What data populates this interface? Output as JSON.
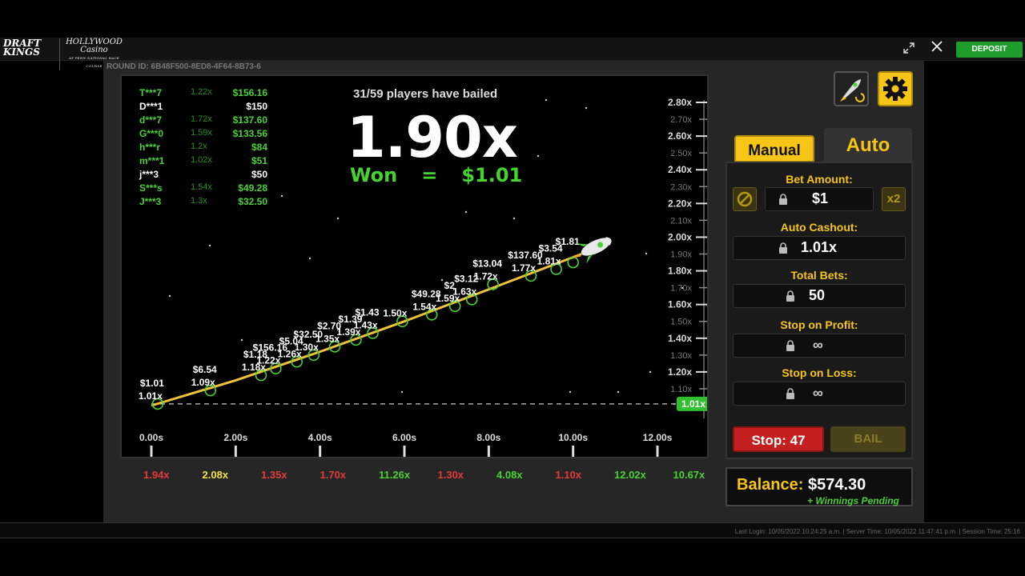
{
  "topbar": {
    "brand_line1": "DRAFT",
    "brand_line2": "KINGS",
    "casino_name": "HOLLYWOOD",
    "casino_name2": "Casino",
    "casino_sub": "AT PENN NATIONAL RACE COURSE",
    "deposit_label": "DEPOSIT"
  },
  "round_id": "ROUND ID: 6B48F500-8ED8-4F64-8B73-6",
  "status": {
    "bail_count": "31/59 players have bailed",
    "multiplier": "1.90x",
    "won_label": "Won",
    "won_eq": "=",
    "won_amount": "$1.01"
  },
  "players": [
    {
      "name": "T***7",
      "mult": "1.22x",
      "amount": "$156.16",
      "color": "green"
    },
    {
      "name": "D***1",
      "mult": "",
      "amount": "$150",
      "color": "white"
    },
    {
      "name": "d***7",
      "mult": "1.72x",
      "amount": "$137.60",
      "color": "green"
    },
    {
      "name": "G***0",
      "mult": "1.59x",
      "amount": "$133.56",
      "color": "green"
    },
    {
      "name": "h***r",
      "mult": "1.2x",
      "amount": "$84",
      "color": "green"
    },
    {
      "name": "m***1",
      "mult": "1.02x",
      "amount": "$51",
      "color": "green"
    },
    {
      "name": "j***3",
      "mult": "",
      "amount": "$50",
      "color": "white"
    },
    {
      "name": "S***s",
      "mult": "1.54x",
      "amount": "$49.28",
      "color": "green"
    },
    {
      "name": "J***3",
      "mult": "1.3x",
      "amount": "$32.50",
      "color": "green"
    }
  ],
  "chart_data": {
    "type": "line",
    "x_ticks": [
      "0.00s",
      "2.00s",
      "4.00s",
      "6.00s",
      "8.00s",
      "10.00s",
      "12.00s"
    ],
    "y_ticks_major": [
      "2.80x",
      "2.60x",
      "2.40x",
      "2.20x",
      "2.00x",
      "1.80x",
      "1.60x",
      "1.40x",
      "1.20x"
    ],
    "y_ticks_minor": [
      "2.70x",
      "2.50x",
      "2.30x",
      "2.10x",
      "1.90x",
      "1.70x",
      "1.50x",
      "1.30x",
      "1.10x"
    ],
    "ylim": [
      1.0,
      2.8
    ],
    "xlim": [
      0,
      12
    ],
    "auto_cashout_marker": "1.01x",
    "curve": [
      {
        "x": 0.0,
        "y": 1.0
      },
      {
        "x": 2.0,
        "y": 1.15
      },
      {
        "x": 4.0,
        "y": 1.32
      },
      {
        "x": 6.0,
        "y": 1.5
      },
      {
        "x": 8.0,
        "y": 1.69
      },
      {
        "x": 10.2,
        "y": 1.9
      }
    ],
    "cashouts": [
      {
        "x": 0.15,
        "y": 1.01,
        "amount": "$1.01",
        "mult": "1.01x"
      },
      {
        "x": 1.4,
        "y": 1.09,
        "amount": "$6.54",
        "mult": "1.09x"
      },
      {
        "x": 2.6,
        "y": 1.18,
        "amount": "$1.18",
        "mult": "1.18x"
      },
      {
        "x": 2.95,
        "y": 1.22,
        "amount": "$156.16",
        "mult": "1.22x"
      },
      {
        "x": 3.45,
        "y": 1.26,
        "amount": "$5.04",
        "mult": "1.26x"
      },
      {
        "x": 3.85,
        "y": 1.3,
        "amount": "$32.50",
        "mult": "1.30x"
      },
      {
        "x": 4.35,
        "y": 1.35,
        "amount": "$2.70",
        "mult": "1.35x"
      },
      {
        "x": 4.85,
        "y": 1.39,
        "amount": "$1.39",
        "mult": "1.39x"
      },
      {
        "x": 5.25,
        "y": 1.43,
        "amount": "$1.43",
        "mult": "1.43x"
      },
      {
        "x": 5.95,
        "y": 1.5,
        "amount": "",
        "mult": "1.50x"
      },
      {
        "x": 6.65,
        "y": 1.54,
        "amount": "$49.28",
        "mult": "1.54x"
      },
      {
        "x": 7.2,
        "y": 1.59,
        "amount": "$2",
        "mult": "1.59x"
      },
      {
        "x": 7.6,
        "y": 1.63,
        "amount": "$3.12",
        "mult": "1.63x"
      },
      {
        "x": 8.1,
        "y": 1.72,
        "amount": "$13.04",
        "mult": "1.72x"
      },
      {
        "x": 9.0,
        "y": 1.77,
        "amount": "$137.60",
        "mult": "1.77x"
      },
      {
        "x": 9.6,
        "y": 1.81,
        "amount": "$3.54",
        "mult": "1.81x"
      },
      {
        "x": 10.0,
        "y": 1.85,
        "amount": "$1.81",
        "mult": ""
      }
    ]
  },
  "history": [
    {
      "value": "1.94x",
      "color": "#e23b3b"
    },
    {
      "value": "2.08x",
      "color": "#f2e14a"
    },
    {
      "value": "1.35x",
      "color": "#e23b3b"
    },
    {
      "value": "1.70x",
      "color": "#e23b3b"
    },
    {
      "value": "11.26x",
      "color": "#49d135"
    },
    {
      "value": "1.30x",
      "color": "#e23b3b"
    },
    {
      "value": "4.08x",
      "color": "#49d135"
    },
    {
      "value": "1.10x",
      "color": "#e23b3b"
    },
    {
      "value": "12.02x",
      "color": "#49d135"
    },
    {
      "value": "10.67x",
      "color": "#49d135"
    }
  ],
  "tabs": {
    "manual": "Manual",
    "auto": "Auto"
  },
  "auto_panel": {
    "bet_amount_label": "Bet Amount:",
    "bet_amount_value": "$1",
    "double_label": "x2",
    "auto_cashout_label": "Auto Cashout:",
    "auto_cashout_value": "1.01x",
    "total_bets_label": "Total Bets:",
    "total_bets_value": "50",
    "stop_profit_label": "Stop on Profit:",
    "stop_profit_value": "∞",
    "stop_loss_label": "Stop on Loss:",
    "stop_loss_value": "∞"
  },
  "buttons": {
    "stop": "Stop: 47",
    "bail": "BAIL"
  },
  "balance": {
    "label": "Balance:",
    "value": "$574.30",
    "pending": "+ Winnings Pending"
  },
  "footer": "Last Login: 10/05/2022 10:24:25 a.m.  |  Server Time: 10/05/2022 11:47:41 p.m.  |  Session Time: 25:16",
  "colors": {
    "accent": "#f6c515",
    "win": "#49d135",
    "loss": "#e23b3b",
    "deposit": "#1e9c2c"
  }
}
